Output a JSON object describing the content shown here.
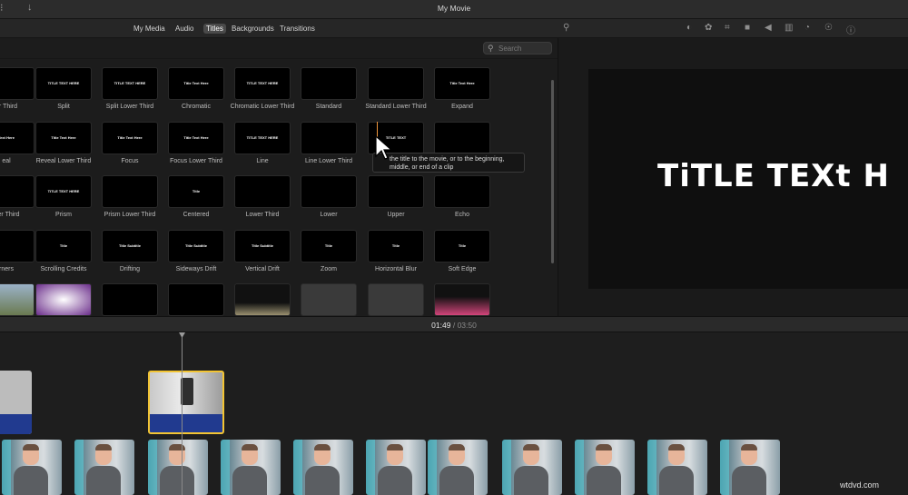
{
  "window": {
    "title": "My Movie"
  },
  "browser": {
    "tabs": [
      "My Media",
      "Audio",
      "Titles",
      "Backgrounds",
      "Transitions"
    ],
    "active_tab": "Titles",
    "search_placeholder": "Search",
    "rows": [
      [
        {
          "label": "er Third",
          "thumb": ""
        },
        {
          "label": "Split",
          "thumb": "TITLE TEXT HERE"
        },
        {
          "label": "Split Lower Third",
          "thumb": "TITLE TEXT HERE"
        },
        {
          "label": "Chromatic",
          "thumb": "Title Text Here"
        },
        {
          "label": "Chromatic Lower Third",
          "thumb": "TITLE TEXT HERE"
        },
        {
          "label": "Standard",
          "thumb": ""
        },
        {
          "label": "Standard Lower Third",
          "thumb": ""
        },
        {
          "label": "Expand",
          "thumb": "Title Text Here"
        }
      ],
      [
        {
          "label": "eal",
          "thumb": "Text Here"
        },
        {
          "label": "Reveal Lower Third",
          "thumb": "Title Text Here"
        },
        {
          "label": "Focus",
          "thumb": "Title Text Here"
        },
        {
          "label": "Focus Lower Third",
          "thumb": "Title Text Here"
        },
        {
          "label": "Line",
          "thumb": "TITLE TEXT HERE"
        },
        {
          "label": "Line Lower Third",
          "thumb": ""
        },
        {
          "label": "",
          "thumb": "TiTLE TEXT"
        },
        {
          "label": "",
          "thumb": ""
        }
      ],
      [
        {
          "label": "wer Third",
          "thumb": ""
        },
        {
          "label": "Prism",
          "thumb": "TITLE TEXT HERE"
        },
        {
          "label": "Prism Lower Third",
          "thumb": ""
        },
        {
          "label": "Centered",
          "thumb": "Title"
        },
        {
          "label": "Lower Third",
          "thumb": ""
        },
        {
          "label": "Lower",
          "thumb": ""
        },
        {
          "label": "Upper",
          "thumb": ""
        },
        {
          "label": "Echo",
          "thumb": ""
        }
      ],
      [
        {
          "label": "rners",
          "thumb": ""
        },
        {
          "label": "Scrolling Credits",
          "thumb": "Title"
        },
        {
          "label": "Drifting",
          "thumb": "Title Subtitle"
        },
        {
          "label": "Sideways Drift",
          "thumb": "Title Subtitle"
        },
        {
          "label": "Vertical Drift",
          "thumb": "Title Subtitle"
        },
        {
          "label": "Zoom",
          "thumb": "Title"
        },
        {
          "label": "Horizontal Blur",
          "thumb": "Title"
        },
        {
          "label": "Soft Edge",
          "thumb": "Title"
        }
      ],
      [
        {
          "label": "",
          "thumb": ""
        },
        {
          "label": "",
          "thumb": ""
        },
        {
          "label": "",
          "thumb": ""
        },
        {
          "label": "",
          "thumb": ""
        },
        {
          "label": "",
          "thumb": ""
        },
        {
          "label": "",
          "thumb": ""
        },
        {
          "label": "",
          "thumb": ""
        },
        {
          "label": "",
          "thumb": ""
        }
      ]
    ],
    "tooltip": "the title to the movie, or to the beginning, middle, or end of a clip"
  },
  "viewer": {
    "toolbar_icons": [
      "color-balance-icon",
      "color-correction-icon",
      "crop-icon",
      "stabilization-icon",
      "volume-icon",
      "equalizer-icon",
      "speed-icon",
      "info-icon"
    ],
    "preview_text": "TiTLE TEXt H"
  },
  "timeline": {
    "current": "01:49",
    "separator": "/",
    "total": "03:50"
  },
  "watermark": "wtdvd.com"
}
